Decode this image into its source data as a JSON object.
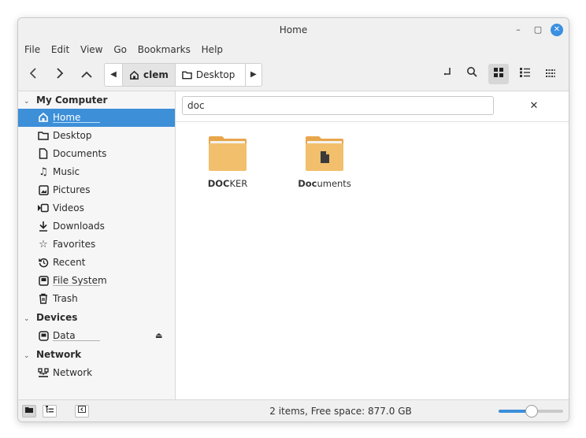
{
  "window": {
    "title": "Home"
  },
  "menu": [
    "File",
    "Edit",
    "View",
    "Go",
    "Bookmarks",
    "Help"
  ],
  "toolbar": {
    "crumbs": [
      {
        "label": "clem",
        "icon": "home-icon",
        "active": true
      },
      {
        "label": "Desktop",
        "icon": "folder-icon",
        "active": false
      }
    ]
  },
  "sidebar": {
    "sections": [
      {
        "title": "My Computer",
        "items": [
          {
            "label": "Home",
            "icon": "home-icon",
            "selected": true,
            "underline": true
          },
          {
            "label": "Desktop",
            "icon": "folder-icon"
          },
          {
            "label": "Documents",
            "icon": "document-icon"
          },
          {
            "label": "Music",
            "icon": "music-icon"
          },
          {
            "label": "Pictures",
            "icon": "picture-icon"
          },
          {
            "label": "Videos",
            "icon": "video-icon"
          },
          {
            "label": "Downloads",
            "icon": "download-icon"
          },
          {
            "label": "Favorites",
            "icon": "star-icon"
          },
          {
            "label": "Recent",
            "icon": "recent-icon"
          },
          {
            "label": "File System",
            "icon": "drive-icon",
            "underline": true
          },
          {
            "label": "Trash",
            "icon": "trash-icon"
          }
        ]
      },
      {
        "title": "Devices",
        "items": [
          {
            "label": "Data",
            "icon": "disk-icon",
            "underline": true,
            "eject": true
          }
        ]
      },
      {
        "title": "Network",
        "items": [
          {
            "label": "Network",
            "icon": "network-icon"
          }
        ]
      }
    ]
  },
  "search": {
    "value": "doc"
  },
  "files": [
    {
      "match": "DOC",
      "rest": "KER",
      "type": "folder"
    },
    {
      "match": "Doc",
      "rest": "uments",
      "type": "documents-folder"
    }
  ],
  "status": {
    "text": "2 items, Free space: 877.0 GB",
    "zoom": 0.5
  },
  "colors": {
    "selection": "#3d8fd8",
    "folder": "#f2bf6c",
    "folder_tab": "#e8a64b"
  }
}
